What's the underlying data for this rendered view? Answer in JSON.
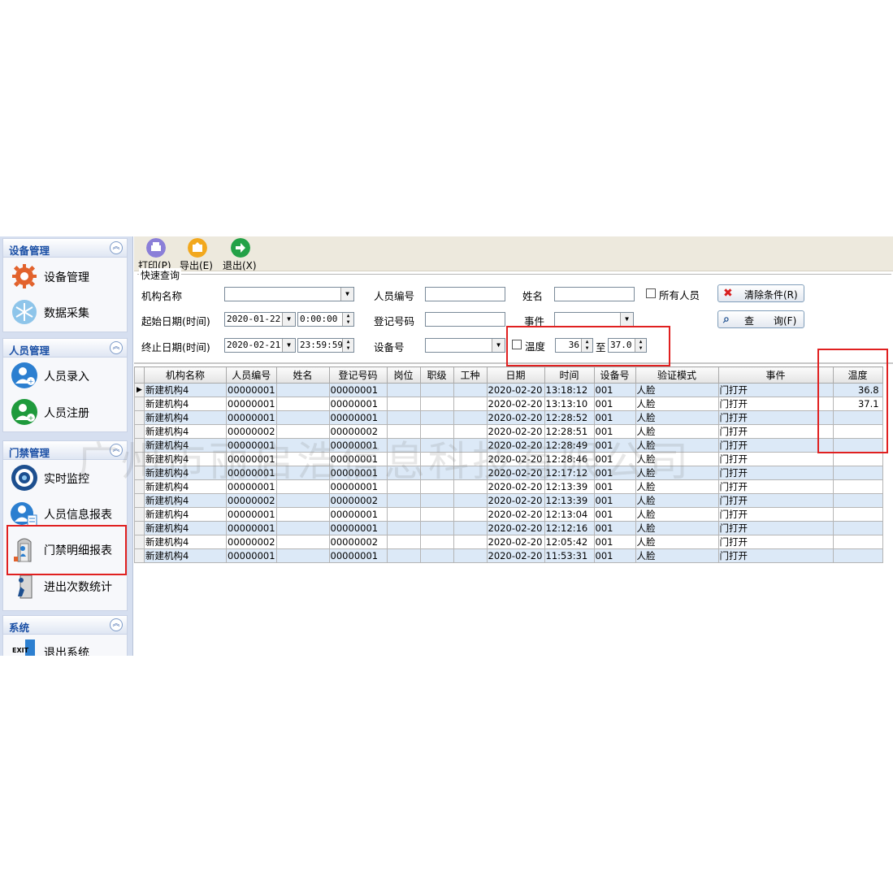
{
  "sidebar": {
    "groups": [
      {
        "title": "设备管理",
        "items": [
          {
            "label": "设备管理",
            "icon": "gear-icon"
          },
          {
            "label": "数据采集",
            "icon": "snowflake-icon"
          }
        ]
      },
      {
        "title": "人员管理",
        "items": [
          {
            "label": "人员录入",
            "icon": "user-add-icon"
          },
          {
            "label": "人员注册",
            "icon": "user-register-icon"
          }
        ]
      },
      {
        "title": "门禁管理",
        "items": [
          {
            "label": "实时监控",
            "icon": "camera-icon"
          },
          {
            "label": "人员信息报表",
            "icon": "person-report-icon"
          },
          {
            "label": "门禁明细报表",
            "icon": "door-report-icon"
          },
          {
            "label": "进出次数统计",
            "icon": "door-exit-icon"
          }
        ]
      },
      {
        "title": "系统",
        "items": [
          {
            "label": "退出系统",
            "icon": "exit-icon"
          }
        ]
      }
    ]
  },
  "toolbar": {
    "print": "打印(P)",
    "export": "导出(E)",
    "exit": "退出(X)"
  },
  "query": {
    "legend": "快速查询",
    "org_label": "机构名称",
    "org_value": "",
    "start_label": "起始日期(时间)",
    "start_date": "2020-01-22",
    "start_time": "0:00:00",
    "end_label": "终止日期(时间)",
    "end_date": "2020-02-21",
    "end_time": "23:59:59",
    "person_no_label": "人员编号",
    "person_no_value": "",
    "reg_no_label": "登记号码",
    "reg_no_value": "",
    "device_label": "设备号",
    "device_value": "",
    "name_label": "姓名",
    "name_value": "",
    "event_label": "事件",
    "event_value": "",
    "temp_label": "温度",
    "temp_from": "36",
    "temp_to_label": "至",
    "temp_to": "37.0",
    "all_persons_label": "所有人员",
    "clear_btn": "清除条件(R)",
    "query_btn": "查　　询(F)"
  },
  "grid": {
    "columns": [
      "机构名称",
      "人员编号",
      "姓名",
      "登记号码",
      "岗位",
      "职级",
      "工种",
      "日期",
      "时间",
      "设备号",
      "验证模式",
      "事件",
      "温度"
    ],
    "rows": [
      [
        "新建机构4",
        "00000001",
        "",
        "00000001",
        "",
        "",
        "",
        "2020-02-20",
        "13:18:12",
        "001",
        "人脸",
        "门打开",
        "36.8"
      ],
      [
        "新建机构4",
        "00000001",
        "",
        "00000001",
        "",
        "",
        "",
        "2020-02-20",
        "13:13:10",
        "001",
        "人脸",
        "门打开",
        "37.1"
      ],
      [
        "新建机构4",
        "00000001",
        "",
        "00000001",
        "",
        "",
        "",
        "2020-02-20",
        "12:28:52",
        "001",
        "人脸",
        "门打开",
        ""
      ],
      [
        "新建机构4",
        "00000002",
        "",
        "00000002",
        "",
        "",
        "",
        "2020-02-20",
        "12:28:51",
        "001",
        "人脸",
        "门打开",
        ""
      ],
      [
        "新建机构4",
        "00000001",
        "",
        "00000001",
        "",
        "",
        "",
        "2020-02-20",
        "12:28:49",
        "001",
        "人脸",
        "门打开",
        ""
      ],
      [
        "新建机构4",
        "00000001",
        "",
        "00000001",
        "",
        "",
        "",
        "2020-02-20",
        "12:28:46",
        "001",
        "人脸",
        "门打开",
        ""
      ],
      [
        "新建机构4",
        "00000001",
        "",
        "00000001",
        "",
        "",
        "",
        "2020-02-20",
        "12:17:12",
        "001",
        "人脸",
        "门打开",
        ""
      ],
      [
        "新建机构4",
        "00000001",
        "",
        "00000001",
        "",
        "",
        "",
        "2020-02-20",
        "12:13:39",
        "001",
        "人脸",
        "门打开",
        ""
      ],
      [
        "新建机构4",
        "00000002",
        "",
        "00000002",
        "",
        "",
        "",
        "2020-02-20",
        "12:13:39",
        "001",
        "人脸",
        "门打开",
        ""
      ],
      [
        "新建机构4",
        "00000001",
        "",
        "00000001",
        "",
        "",
        "",
        "2020-02-20",
        "12:13:04",
        "001",
        "人脸",
        "门打开",
        ""
      ],
      [
        "新建机构4",
        "00000001",
        "",
        "00000001",
        "",
        "",
        "",
        "2020-02-20",
        "12:12:16",
        "001",
        "人脸",
        "门打开",
        ""
      ],
      [
        "新建机构4",
        "00000002",
        "",
        "00000002",
        "",
        "",
        "",
        "2020-02-20",
        "12:05:42",
        "001",
        "人脸",
        "门打开",
        ""
      ],
      [
        "新建机构4",
        "00000001",
        "",
        "00000001",
        "",
        "",
        "",
        "2020-02-20",
        "11:53:31",
        "001",
        "人脸",
        "门打开",
        ""
      ]
    ]
  },
  "watermark": "广州市丽启浩信息科技有限公司",
  "colors": {
    "highlight": "#e02020",
    "row_alt": "#dce9f7",
    "sidebar_bg": "#d6dff0"
  }
}
